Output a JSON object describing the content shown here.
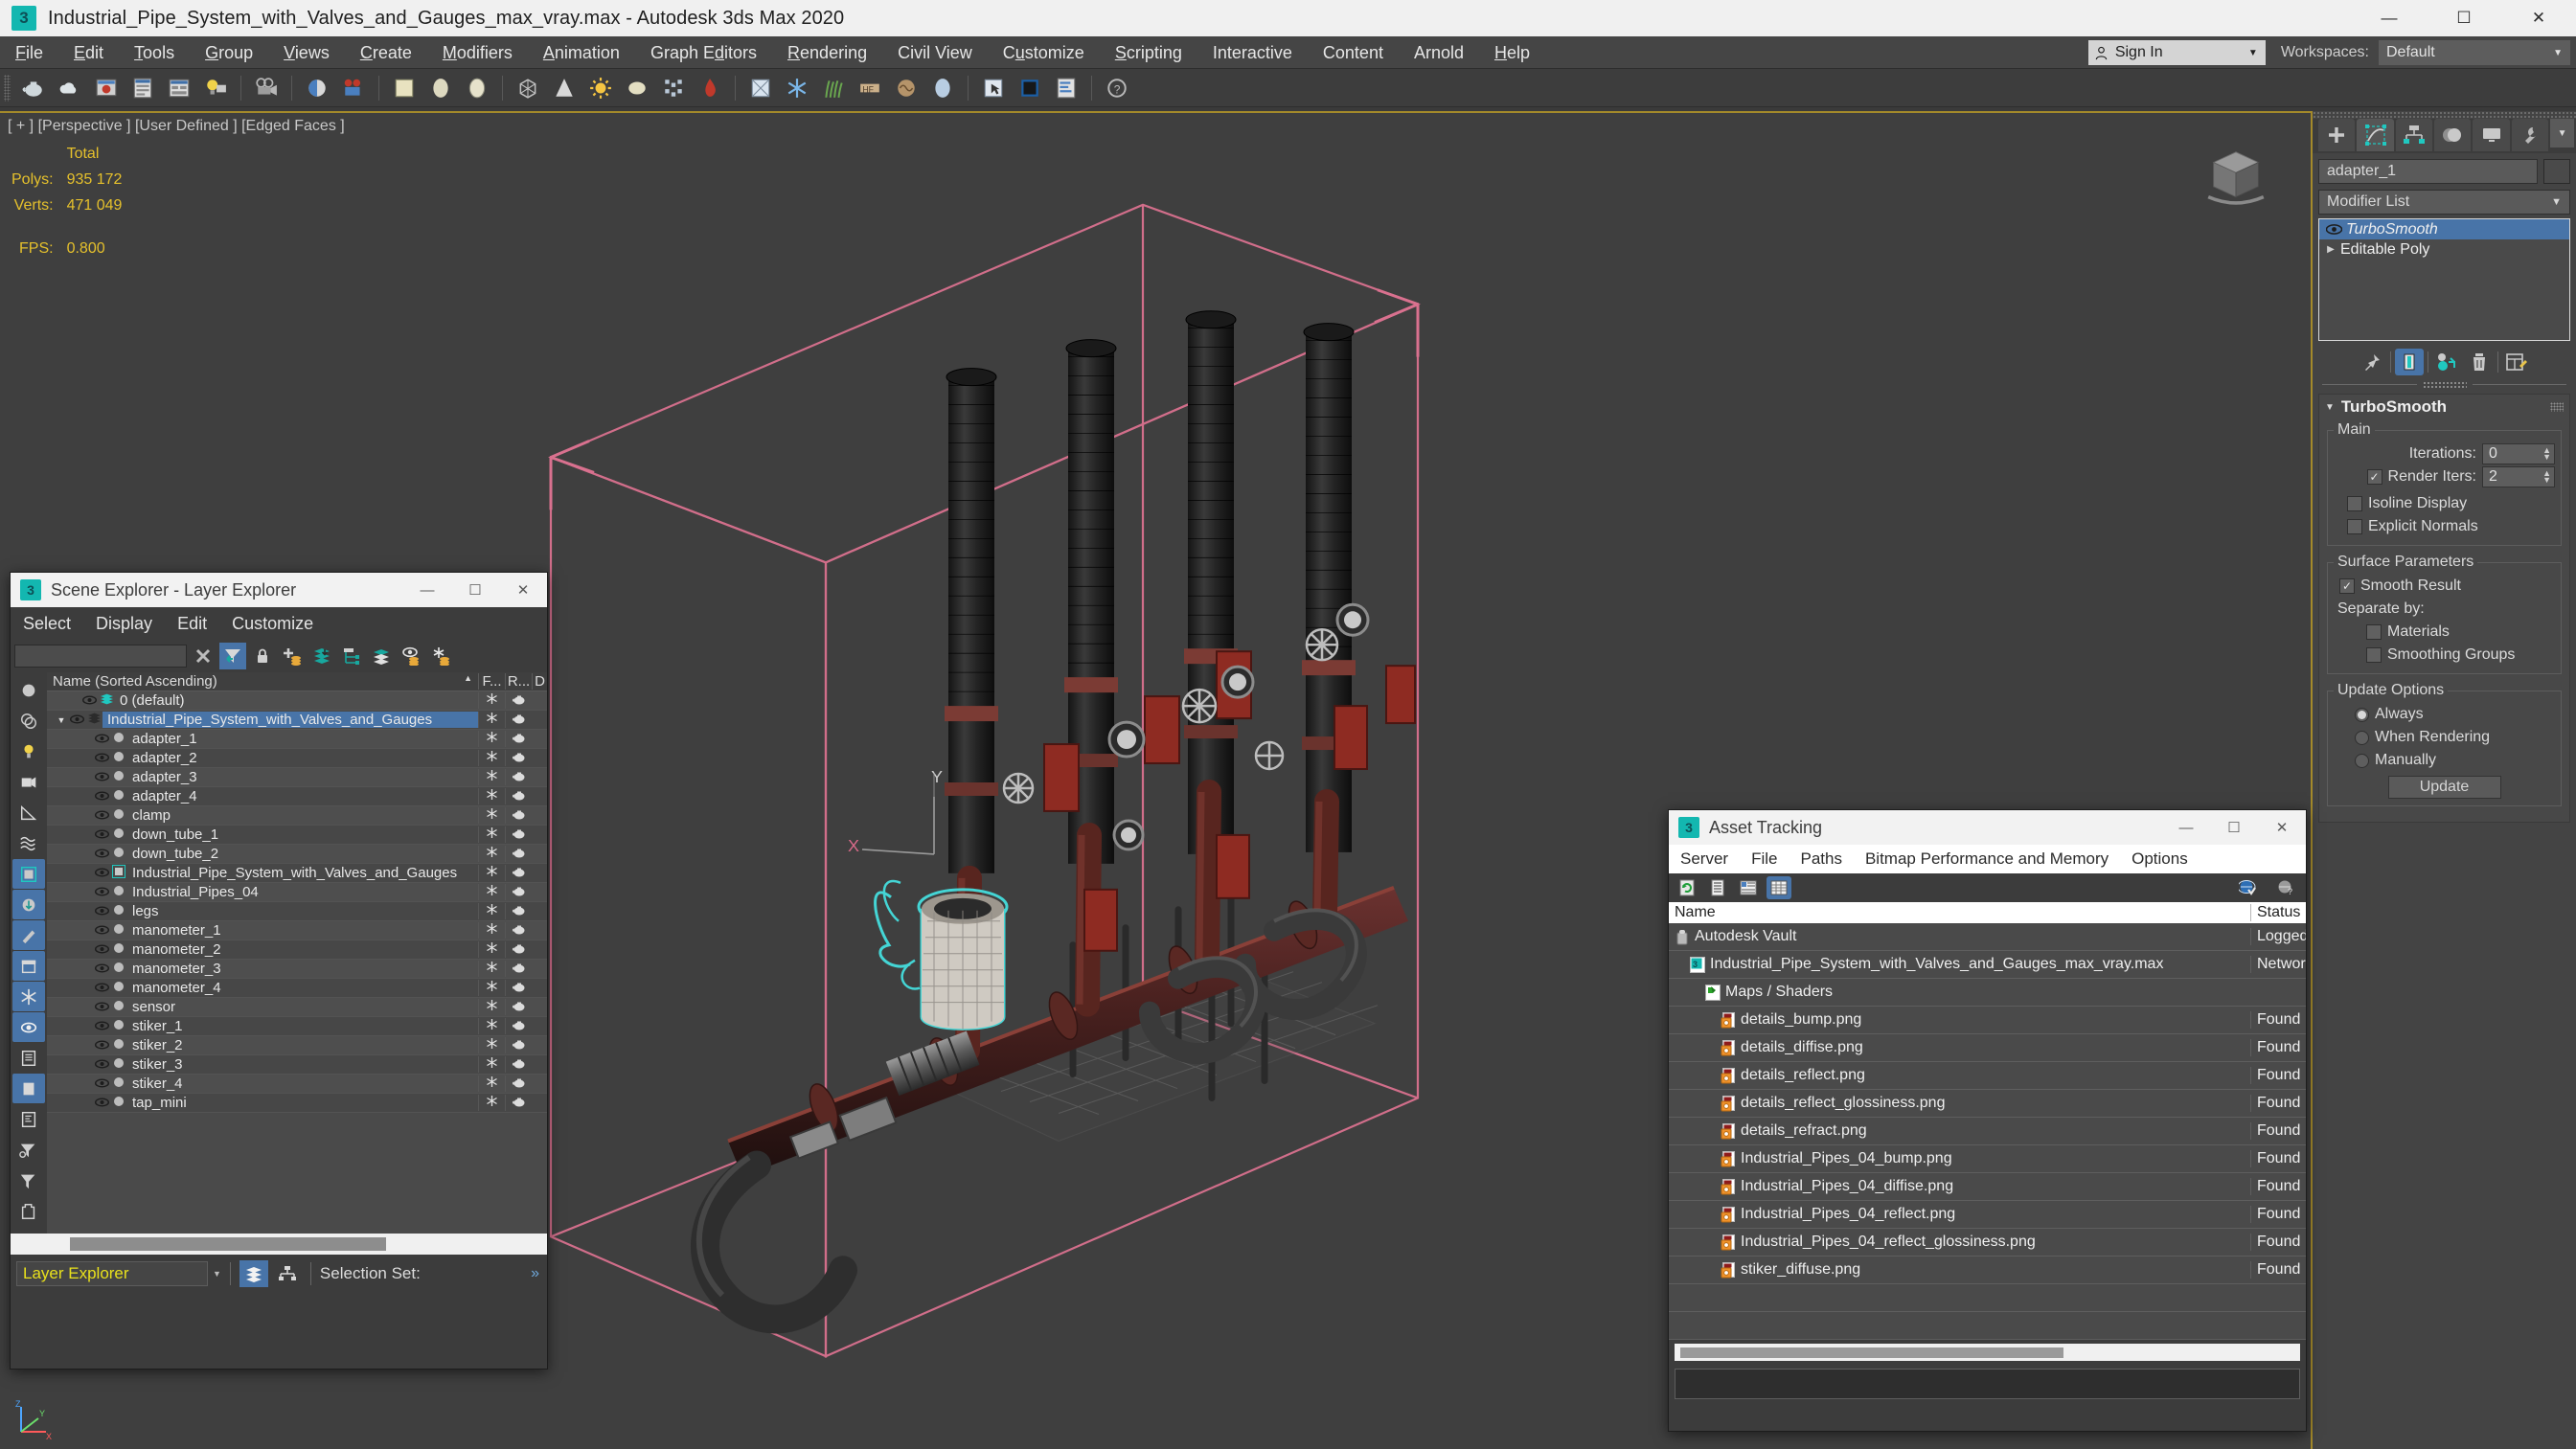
{
  "window": {
    "title": "Industrial_Pipe_System_with_Valves_and_Gauges_max_vray.max - Autodesk 3ds Max 2020",
    "app_icon": "3dsmax-icon",
    "minimize": "—",
    "maximize": "☐",
    "close": "✕"
  },
  "menubar": {
    "items": [
      {
        "label": "File",
        "mnemonic": "F"
      },
      {
        "label": "Edit",
        "mnemonic": "E"
      },
      {
        "label": "Tools",
        "mnemonic": "T"
      },
      {
        "label": "Group",
        "mnemonic": "G"
      },
      {
        "label": "Views",
        "mnemonic": "V"
      },
      {
        "label": "Create",
        "mnemonic": "C"
      },
      {
        "label": "Modifiers",
        "mnemonic": "M"
      },
      {
        "label": "Animation",
        "mnemonic": "A"
      },
      {
        "label": "Graph Editors",
        "mnemonic": "d"
      },
      {
        "label": "Rendering",
        "mnemonic": "R"
      },
      {
        "label": "Civil View",
        "mnemonic": ""
      },
      {
        "label": "Customize",
        "mnemonic": "u"
      },
      {
        "label": "Scripting",
        "mnemonic": "S"
      },
      {
        "label": "Interactive",
        "mnemonic": ""
      },
      {
        "label": "Content",
        "mnemonic": ""
      },
      {
        "label": "Arnold",
        "mnemonic": ""
      },
      {
        "label": "Help",
        "mnemonic": "H"
      }
    ],
    "sign_in": "Sign In",
    "workspaces_label": "Workspaces:",
    "workspace_value": "Default"
  },
  "toolbar": {
    "icons": [
      "teapot-icon",
      "cloud-icon",
      "render-frame-window-icon",
      "render-setup-icon",
      "rendered-frame-icon",
      "light-render-icon",
      "camera-icon",
      "material-editor-icon",
      "render-production-icon",
      "slate-material-icon",
      "environment-icon",
      "sphere-icon",
      "lattice-icon",
      "cone-icon",
      "sun-icon",
      "ellipse-icon",
      "noise-icon",
      "liquid-icon",
      "proxy-icon",
      "ice-icon",
      "fur-icon",
      "hair-icon",
      "displacement-icon",
      "blob-icon",
      "select-object-icon",
      "vray-frame-buffer-icon",
      "vray-toolbar-icon",
      "help-icon"
    ]
  },
  "viewport": {
    "label": "[ + ] [Perspective ] [User Defined ] [Edged Faces ]",
    "stats": {
      "header": "Total",
      "polys_label": "Polys:",
      "polys_value": "935 172",
      "verts_label": "Verts:",
      "verts_value": "471 049",
      "fps_label": "FPS:",
      "fps_value": "0.800"
    },
    "axis_labels": {
      "x": "X",
      "y": "Y",
      "z": "Z"
    },
    "viewcube": "view-cube-icon"
  },
  "command_panel": {
    "tabs": [
      {
        "name": "create-tab",
        "icon": "plus-icon",
        "active": false
      },
      {
        "name": "modify-tab",
        "icon": "modify-icon",
        "active": true
      },
      {
        "name": "hierarchy-tab",
        "icon": "hierarchy-icon",
        "active": false
      },
      {
        "name": "motion-tab",
        "icon": "motion-icon",
        "active": false
      },
      {
        "name": "display-tab",
        "icon": "display-icon",
        "active": false
      },
      {
        "name": "utilities-tab",
        "icon": "utilities-icon",
        "active": false
      }
    ],
    "object_name": "adapter_1",
    "modifier_list_label": "Modifier List",
    "stack": [
      {
        "label": "TurboSmooth",
        "selected": true,
        "italic": true
      },
      {
        "label": "Editable Poly",
        "selected": false,
        "italic": false
      }
    ],
    "stack_tools": [
      "pin-stack-icon",
      "show-end-result-icon",
      "make-unique-icon",
      "remove-modifier-icon",
      "configure-modifier-sets-icon"
    ],
    "rollup": {
      "title": "TurboSmooth",
      "main_group": "Main",
      "iterations_label": "Iterations:",
      "iterations_value": "0",
      "render_iters_label": "Render Iters:",
      "render_iters_value": "2",
      "render_iters_checked": true,
      "isoline_display": "Isoline Display",
      "isoline_checked": false,
      "explicit_normals": "Explicit Normals",
      "explicit_checked": false,
      "surface_group": "Surface Parameters",
      "smooth_result": "Smooth Result",
      "smooth_result_checked": true,
      "separate_by": "Separate by:",
      "materials": "Materials",
      "materials_checked": false,
      "smoothing_groups": "Smoothing Groups",
      "smoothing_groups_checked": false,
      "update_group": "Update Options",
      "update_options": [
        {
          "label": "Always",
          "selected": true
        },
        {
          "label": "When Rendering",
          "selected": false
        },
        {
          "label": "Manually",
          "selected": false
        }
      ],
      "update_button": "Update"
    }
  },
  "scene_explorer": {
    "title": "Scene Explorer - Layer Explorer",
    "minimize": "—",
    "maximize": "☐",
    "close": "✕",
    "menu": [
      "Select",
      "Display",
      "Edit",
      "Customize"
    ],
    "search_value": "",
    "toolbar_icons": [
      "clear-search-icon",
      "filter-selected-icon",
      "lock-icon",
      "add-layer-icon",
      "add-selection-to-layer-icon",
      "select-child-nodes-icon",
      "layers-icon",
      "hide-layer-icon",
      "freeze-layer-icon"
    ],
    "side_icons": [
      "geometry-filter-icon",
      "shapes-filter-icon",
      "lights-filter-icon",
      "cameras-filter-icon",
      "helpers-filter-icon",
      "space-warps-filter-icon",
      "xref-filter-icon",
      "bone-filter-icon",
      "particle-filter-icon",
      "container-filter-icon",
      "frozen-filter-icon",
      "hidden-filter-icon",
      "groups-filter-icon",
      "layers-panel-icon",
      "display-column-icon",
      "advanced-filter-icon",
      "filter-icon",
      "selection-set-icon"
    ],
    "columns": {
      "name": "Name (Sorted Ascending)",
      "sort_arrow": "▲",
      "frozen": "F...",
      "render": "R...",
      "display": "D"
    },
    "rows": [
      {
        "name": "0 (default)",
        "depth": 1,
        "type": "layer",
        "selected": false,
        "expand": ""
      },
      {
        "name": "Industrial_Pipe_System_with_Valves_and_Gauges",
        "depth": 0,
        "type": "layer-dark",
        "selected": true,
        "expand": "▼"
      },
      {
        "name": "adapter_1",
        "depth": 2,
        "type": "object",
        "selected": false,
        "expand": ""
      },
      {
        "name": "adapter_2",
        "depth": 2,
        "type": "object",
        "selected": false,
        "expand": ""
      },
      {
        "name": "adapter_3",
        "depth": 2,
        "type": "object",
        "selected": false,
        "expand": ""
      },
      {
        "name": "adapter_4",
        "depth": 2,
        "type": "object",
        "selected": false,
        "expand": ""
      },
      {
        "name": "clamp",
        "depth": 2,
        "type": "object",
        "selected": false,
        "expand": ""
      },
      {
        "name": "down_tube_1",
        "depth": 2,
        "type": "object",
        "selected": false,
        "expand": ""
      },
      {
        "name": "down_tube_2",
        "depth": 2,
        "type": "object",
        "selected": false,
        "expand": ""
      },
      {
        "name": "Industrial_Pipe_System_with_Valves_and_Gauges",
        "depth": 2,
        "type": "xref",
        "selected": false,
        "expand": ""
      },
      {
        "name": "Industrial_Pipes_04",
        "depth": 2,
        "type": "object",
        "selected": false,
        "expand": ""
      },
      {
        "name": "legs",
        "depth": 2,
        "type": "object",
        "selected": false,
        "expand": ""
      },
      {
        "name": "manometer_1",
        "depth": 2,
        "type": "object",
        "selected": false,
        "expand": ""
      },
      {
        "name": "manometer_2",
        "depth": 2,
        "type": "object",
        "selected": false,
        "expand": ""
      },
      {
        "name": "manometer_3",
        "depth": 2,
        "type": "object",
        "selected": false,
        "expand": ""
      },
      {
        "name": "manometer_4",
        "depth": 2,
        "type": "object",
        "selected": false,
        "expand": ""
      },
      {
        "name": "sensor",
        "depth": 2,
        "type": "object",
        "selected": false,
        "expand": ""
      },
      {
        "name": "stiker_1",
        "depth": 2,
        "type": "object",
        "selected": false,
        "expand": ""
      },
      {
        "name": "stiker_2",
        "depth": 2,
        "type": "object",
        "selected": false,
        "expand": ""
      },
      {
        "name": "stiker_3",
        "depth": 2,
        "type": "object",
        "selected": false,
        "expand": ""
      },
      {
        "name": "stiker_4",
        "depth": 2,
        "type": "object",
        "selected": false,
        "expand": ""
      },
      {
        "name": "tap_mini",
        "depth": 2,
        "type": "object",
        "selected": false,
        "expand": ""
      }
    ],
    "footer": {
      "mode": "Layer Explorer",
      "selection_set_label": "Selection Set:",
      "chevron": "»"
    }
  },
  "asset_tracking": {
    "title": "Asset Tracking",
    "minimize": "—",
    "maximize": "☐",
    "close": "✕",
    "menu": [
      "Server",
      "File",
      "Paths",
      "Bitmap Performance and Memory",
      "Options"
    ],
    "toolbar_icons": [
      "refresh-icon",
      "list-view-icon",
      "detail-view-icon",
      "grid-view-icon"
    ],
    "toolbar_right_icons": [
      "globe-check-icon",
      "globe-question-icon"
    ],
    "columns": {
      "name": "Name",
      "status": "Status"
    },
    "rows": [
      {
        "name": "Autodesk Vault",
        "status": "Logged.",
        "depth": 0,
        "icon": "vault-icon"
      },
      {
        "name": "Industrial_Pipe_System_with_Valves_and_Gauges_max_vray.max",
        "status": "Networ..",
        "depth": 1,
        "icon": "max-file-icon"
      },
      {
        "name": "Maps / Shaders",
        "status": "",
        "depth": 2,
        "icon": "maps-shaders-icon"
      },
      {
        "name": "details_bump.png",
        "status": "Found",
        "depth": 3,
        "icon": "png-icon"
      },
      {
        "name": "details_diffise.png",
        "status": "Found",
        "depth": 3,
        "icon": "png-icon"
      },
      {
        "name": "details_reflect.png",
        "status": "Found",
        "depth": 3,
        "icon": "png-icon"
      },
      {
        "name": "details_reflect_glossiness.png",
        "status": "Found",
        "depth": 3,
        "icon": "png-icon"
      },
      {
        "name": "details_refract.png",
        "status": "Found",
        "depth": 3,
        "icon": "png-icon"
      },
      {
        "name": "Industrial_Pipes_04_bump.png",
        "status": "Found",
        "depth": 3,
        "icon": "png-icon"
      },
      {
        "name": "Industrial_Pipes_04_diffise.png",
        "status": "Found",
        "depth": 3,
        "icon": "png-icon"
      },
      {
        "name": "Industrial_Pipes_04_reflect.png",
        "status": "Found",
        "depth": 3,
        "icon": "png-icon"
      },
      {
        "name": "Industrial_Pipes_04_reflect_glossiness.png",
        "status": "Found",
        "depth": 3,
        "icon": "png-icon"
      },
      {
        "name": "stiker_diffuse.png",
        "status": "Found",
        "depth": 3,
        "icon": "png-icon"
      },
      {
        "name": "",
        "status": "",
        "depth": 0,
        "icon": ""
      },
      {
        "name": "",
        "status": "",
        "depth": 0,
        "icon": ""
      }
    ]
  },
  "colors": {
    "accent_blue": "#4874a8",
    "viewport_border": "#a48a2a",
    "stats_yellow": "#e5c02c",
    "teal": "#13b7b0",
    "selection_cyan": "#3fe0e0",
    "wire_pink": "#d9718f"
  }
}
